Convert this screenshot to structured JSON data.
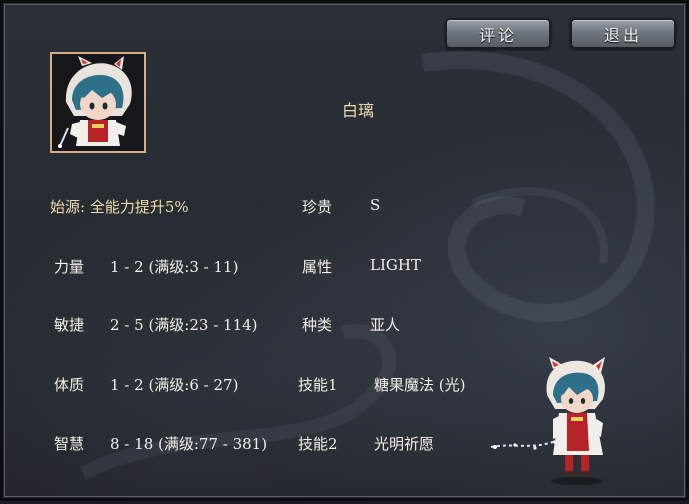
{
  "buttons": {
    "review_label": "评论",
    "exit_label": "退出"
  },
  "character": {
    "name": "白璃",
    "origin": "始源: 全能力提升5%"
  },
  "stats": {
    "strength": {
      "label": "力量",
      "value": "1 - 2 (满级:3 - 11)"
    },
    "agility": {
      "label": "敏捷",
      "value": "2 - 5 (满级:23 - 114)"
    },
    "constitution": {
      "label": "体质",
      "value": "1 - 2 (满级:6 - 27)"
    },
    "wisdom": {
      "label": "智慧",
      "value": "8 - 18 (满级:77 - 381)"
    }
  },
  "info": {
    "rarity": {
      "label": "珍贵",
      "value": "S"
    },
    "attribute": {
      "label": "属性",
      "value": "LIGHT"
    },
    "race": {
      "label": "种类",
      "value": "亚人"
    },
    "skill1": {
      "label": "技能1",
      "value": "糖果魔法 (光)"
    },
    "skill2": {
      "label": "技能2",
      "value": "光明祈愿"
    }
  },
  "icons": {
    "portrait": "character-portrait",
    "sprite": "character-sprite"
  },
  "colors": {
    "gold_text": "#efdcae",
    "white_text": "#f3efe6",
    "portrait_border": "#d7ad86"
  }
}
